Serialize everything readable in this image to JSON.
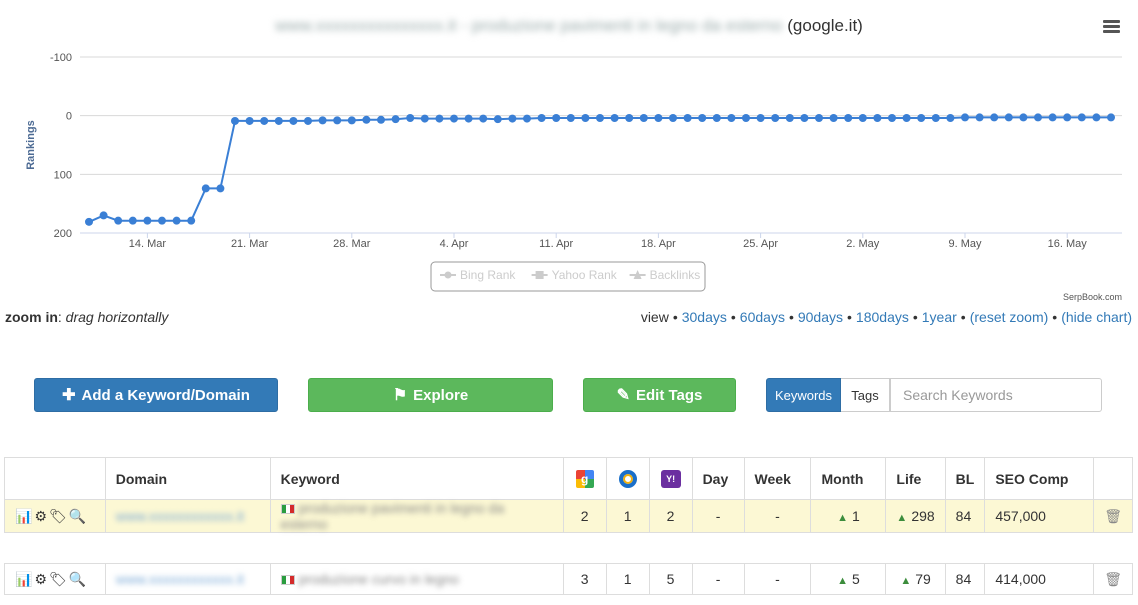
{
  "chart": {
    "title_blurred": "www.xxxxxxxxxxxxxxx.it - produzione pavimenti in legno da esterno",
    "title_engine": "(google.it)",
    "credit": "SerpBook.com",
    "legend": [
      "Bing Rank",
      "Yahoo Rank",
      "Backlinks"
    ]
  },
  "chart_data": {
    "type": "line",
    "title": "",
    "ylabel": "Rankings",
    "ylim": [
      200,
      -100
    ],
    "y_ticks": [
      "-100",
      "0",
      "100",
      "200"
    ],
    "x_tick_labels": [
      "14. Mar",
      "21. Mar",
      "28. Mar",
      "4. Apr",
      "11. Apr",
      "18. Apr",
      "25. Apr",
      "2. May",
      "9. May",
      "16. May"
    ],
    "x_start": "2017-03-10",
    "series": [
      {
        "name": "",
        "color": "#3a7fd5",
        "values": [
          181,
          170,
          179,
          179,
          179,
          179,
          179,
          179,
          124,
          124,
          9,
          9,
          9,
          9,
          9,
          9,
          8,
          8,
          8,
          7,
          7,
          6,
          4,
          5,
          5,
          5,
          5,
          5,
          6,
          5,
          5,
          4,
          4,
          4,
          4,
          4,
          4,
          4,
          4,
          4,
          4,
          4,
          4,
          4,
          4,
          4,
          4,
          4,
          4,
          4,
          4,
          4,
          4,
          4,
          4,
          4,
          4,
          4,
          4,
          4,
          3,
          3,
          3,
          3,
          3,
          3,
          3,
          3,
          3,
          3,
          3
        ]
      }
    ],
    "grid": true,
    "legend_position": "bottom"
  },
  "zoom": {
    "label": "zoom in",
    "hint": "drag horizontally",
    "view_label": "view",
    "links": [
      "30days",
      "60days",
      "90days",
      "180days",
      "1year",
      "(reset zoom)",
      "(hide chart)"
    ]
  },
  "actions": {
    "add_label": "Add a Keyword/Domain",
    "explore_label": "Explore",
    "edit_tags_label": "Edit Tags",
    "tab_keywords": "Keywords",
    "tab_tags": "Tags",
    "search_placeholder": "Search Keywords"
  },
  "table": {
    "headers": {
      "domain": "Domain",
      "keyword": "Keyword",
      "google": "g",
      "yahoo": "Y!",
      "day": "Day",
      "week": "Week",
      "month": "Month",
      "life": "Life",
      "bl": "BL",
      "seo": "SEO Comp"
    },
    "rows": [
      {
        "domain": "www.xxxxxxxxxxxx.it",
        "keyword": "produzione pavimenti in legno da esterno",
        "google": "2",
        "bing": "1",
        "yahoo": "2",
        "day": "-",
        "week": "-",
        "month": "1",
        "life": "298",
        "bl": "84",
        "seo": "457,000"
      },
      {
        "domain": "www.xxxxxxxxxxxx.it",
        "keyword": "produzione curvo in legno",
        "google": "3",
        "bing": "1",
        "yahoo": "5",
        "day": "-",
        "week": "-",
        "month": "5",
        "life": "79",
        "bl": "84",
        "seo": "414,000"
      }
    ]
  }
}
